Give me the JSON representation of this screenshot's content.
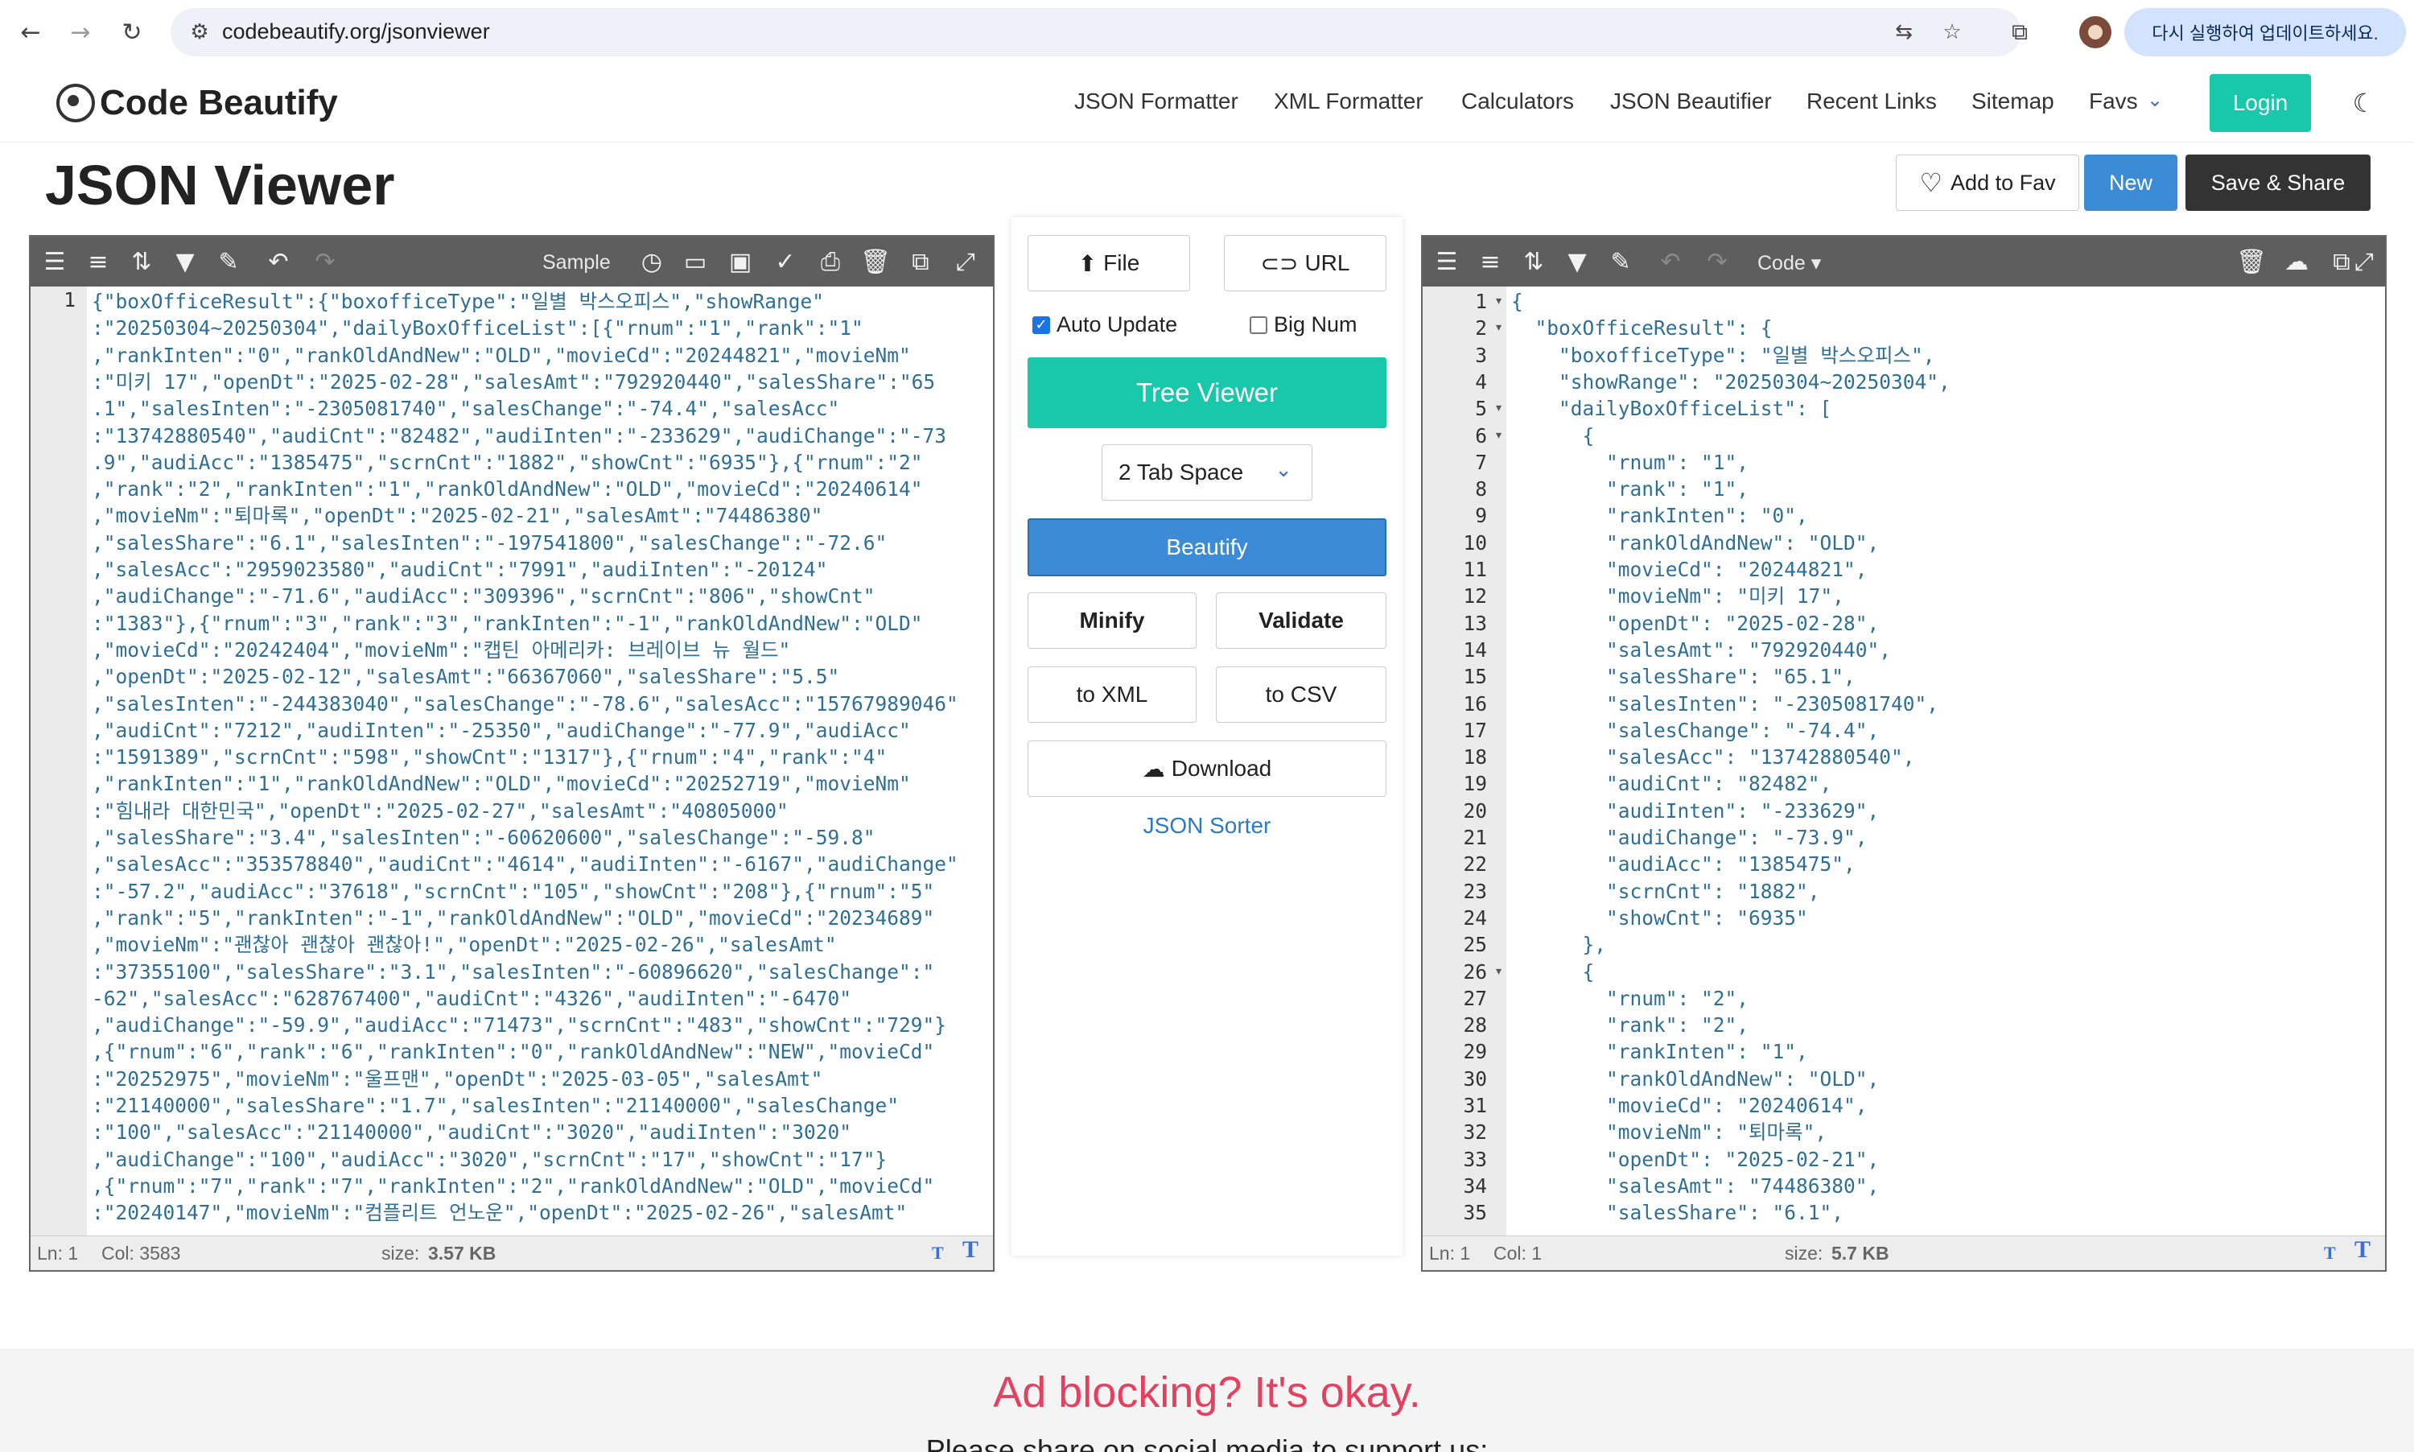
{
  "browser": {
    "url": "codebeautify.org/jsonviewer",
    "update_text": "다시 실행하여 업데이트하세요."
  },
  "site": {
    "logo_text": "Code Beautify",
    "nav": [
      "JSON Formatter",
      "XML Formatter",
      "Calculators",
      "JSON Beautifier",
      "Recent Links",
      "Sitemap",
      "Favs"
    ],
    "login_label": "Login"
  },
  "page": {
    "title": "JSON Viewer",
    "add_fav_label": "Add to Fav",
    "new_label": "New",
    "save_share_label": "Save & Share"
  },
  "left_editor": {
    "sample_label": "Sample",
    "status": {
      "ln": "Ln: 1",
      "col": "Col: 3583",
      "size_label": "size:",
      "size_value": "3.57 KB"
    },
    "gutter_first": "1",
    "lines": [
      "{\"boxOfficeResult\":{\"boxofficeType\":\"일별 박스오피스\",\"showRange\"",
      ":\"20250304~20250304\",\"dailyBoxOfficeList\":[{\"rnum\":\"1\",\"rank\":\"1\"",
      ",\"rankInten\":\"0\",\"rankOldAndNew\":\"OLD\",\"movieCd\":\"20244821\",\"movieNm\"",
      ":\"미키 17\",\"openDt\":\"2025-02-28\",\"salesAmt\":\"792920440\",\"salesShare\":\"65",
      ".1\",\"salesInten\":\"-2305081740\",\"salesChange\":\"-74.4\",\"salesAcc\"",
      ":\"13742880540\",\"audiCnt\":\"82482\",\"audiInten\":\"-233629\",\"audiChange\":\"-73",
      ".9\",\"audiAcc\":\"1385475\",\"scrnCnt\":\"1882\",\"showCnt\":\"6935\"},{\"rnum\":\"2\"",
      ",\"rank\":\"2\",\"rankInten\":\"1\",\"rankOldAndNew\":\"OLD\",\"movieCd\":\"20240614\"",
      ",\"movieNm\":\"퇴마록\",\"openDt\":\"2025-02-21\",\"salesAmt\":\"74486380\"",
      ",\"salesShare\":\"6.1\",\"salesInten\":\"-197541800\",\"salesChange\":\"-72.6\"",
      ",\"salesAcc\":\"2959023580\",\"audiCnt\":\"7991\",\"audiInten\":\"-20124\"",
      ",\"audiChange\":\"-71.6\",\"audiAcc\":\"309396\",\"scrnCnt\":\"806\",\"showCnt\"",
      ":\"1383\"},{\"rnum\":\"3\",\"rank\":\"3\",\"rankInten\":\"-1\",\"rankOldAndNew\":\"OLD\"",
      ",\"movieCd\":\"20242404\",\"movieNm\":\"캡틴 아메리카: 브레이브 뉴 월드\"",
      ",\"openDt\":\"2025-02-12\",\"salesAmt\":\"66367060\",\"salesShare\":\"5.5\"",
      ",\"salesInten\":\"-244383040\",\"salesChange\":\"-78.6\",\"salesAcc\":\"15767989046\"",
      ",\"audiCnt\":\"7212\",\"audiInten\":\"-25350\",\"audiChange\":\"-77.9\",\"audiAcc\"",
      ":\"1591389\",\"scrnCnt\":\"598\",\"showCnt\":\"1317\"},{\"rnum\":\"4\",\"rank\":\"4\"",
      ",\"rankInten\":\"1\",\"rankOldAndNew\":\"OLD\",\"movieCd\":\"20252719\",\"movieNm\"",
      ":\"힘내라 대한민국\",\"openDt\":\"2025-02-27\",\"salesAmt\":\"40805000\"",
      ",\"salesShare\":\"3.4\",\"salesInten\":\"-60620600\",\"salesChange\":\"-59.8\"",
      ",\"salesAcc\":\"353578840\",\"audiCnt\":\"4614\",\"audiInten\":\"-6167\",\"audiChange\"",
      ":\"-57.2\",\"audiAcc\":\"37618\",\"scrnCnt\":\"105\",\"showCnt\":\"208\"},{\"rnum\":\"5\"",
      ",\"rank\":\"5\",\"rankInten\":\"-1\",\"rankOldAndNew\":\"OLD\",\"movieCd\":\"20234689\"",
      ",\"movieNm\":\"괜찮아 괜찮아 괜찮아!\",\"openDt\":\"2025-02-26\",\"salesAmt\"",
      ":\"37355100\",\"salesShare\":\"3.1\",\"salesInten\":\"-60896620\",\"salesChange\":\"",
      "-62\",\"salesAcc\":\"628767400\",\"audiCnt\":\"4326\",\"audiInten\":\"-6470\"",
      ",\"audiChange\":\"-59.9\",\"audiAcc\":\"71473\",\"scrnCnt\":\"483\",\"showCnt\":\"729\"}",
      ",{\"rnum\":\"6\",\"rank\":\"6\",\"rankInten\":\"0\",\"rankOldAndNew\":\"NEW\",\"movieCd\"",
      ":\"20252975\",\"movieNm\":\"울프맨\",\"openDt\":\"2025-03-05\",\"salesAmt\"",
      ":\"21140000\",\"salesShare\":\"1.7\",\"salesInten\":\"21140000\",\"salesChange\"",
      ":\"100\",\"salesAcc\":\"21140000\",\"audiCnt\":\"3020\",\"audiInten\":\"3020\"",
      ",\"audiChange\":\"100\",\"audiAcc\":\"3020\",\"scrnCnt\":\"17\",\"showCnt\":\"17\"}",
      ",{\"rnum\":\"7\",\"rank\":\"7\",\"rankInten\":\"2\",\"rankOldAndNew\":\"OLD\",\"movieCd\"",
      ":\"20240147\",\"movieNm\":\"컴플리트 언노운\",\"openDt\":\"2025-02-26\",\"salesAmt\""
    ]
  },
  "middle": {
    "file_label": "File",
    "url_label": "URL",
    "auto_update_label": "Auto Update",
    "auto_update_checked": true,
    "big_num_label": "Big Num",
    "big_num_checked": false,
    "tree_viewer_label": "Tree Viewer",
    "tab_space_value": "2 Tab Space",
    "beautify_label": "Beautify",
    "minify_label": "Minify",
    "validate_label": "Validate",
    "to_xml_label": "to XML",
    "to_csv_label": "to CSV",
    "download_label": "Download",
    "json_sorter_label": "JSON Sorter"
  },
  "right_editor": {
    "code_label": "Code",
    "status": {
      "ln": "Ln: 1",
      "col": "Col: 1",
      "size_label": "size:",
      "size_value": "5.7 KB"
    },
    "lines": [
      {
        "n": "1",
        "fold": true,
        "t": "{"
      },
      {
        "n": "2",
        "fold": true,
        "t": "  \"boxOfficeResult\": {"
      },
      {
        "n": "3",
        "fold": false,
        "t": "    \"boxofficeType\": \"일별 박스오피스\","
      },
      {
        "n": "4",
        "fold": false,
        "t": "    \"showRange\": \"20250304~20250304\","
      },
      {
        "n": "5",
        "fold": true,
        "t": "    \"dailyBoxOfficeList\": ["
      },
      {
        "n": "6",
        "fold": true,
        "t": "      {"
      },
      {
        "n": "7",
        "fold": false,
        "t": "        \"rnum\": \"1\","
      },
      {
        "n": "8",
        "fold": false,
        "t": "        \"rank\": \"1\","
      },
      {
        "n": "9",
        "fold": false,
        "t": "        \"rankInten\": \"0\","
      },
      {
        "n": "10",
        "fold": false,
        "t": "        \"rankOldAndNew\": \"OLD\","
      },
      {
        "n": "11",
        "fold": false,
        "t": "        \"movieCd\": \"20244821\","
      },
      {
        "n": "12",
        "fold": false,
        "t": "        \"movieNm\": \"미키 17\","
      },
      {
        "n": "13",
        "fold": false,
        "t": "        \"openDt\": \"2025-02-28\","
      },
      {
        "n": "14",
        "fold": false,
        "t": "        \"salesAmt\": \"792920440\","
      },
      {
        "n": "15",
        "fold": false,
        "t": "        \"salesShare\": \"65.1\","
      },
      {
        "n": "16",
        "fold": false,
        "t": "        \"salesInten\": \"-2305081740\","
      },
      {
        "n": "17",
        "fold": false,
        "t": "        \"salesChange\": \"-74.4\","
      },
      {
        "n": "18",
        "fold": false,
        "t": "        \"salesAcc\": \"13742880540\","
      },
      {
        "n": "19",
        "fold": false,
        "t": "        \"audiCnt\": \"82482\","
      },
      {
        "n": "20",
        "fold": false,
        "t": "        \"audiInten\": \"-233629\","
      },
      {
        "n": "21",
        "fold": false,
        "t": "        \"audiChange\": \"-73.9\","
      },
      {
        "n": "22",
        "fold": false,
        "t": "        \"audiAcc\": \"1385475\","
      },
      {
        "n": "23",
        "fold": false,
        "t": "        \"scrnCnt\": \"1882\","
      },
      {
        "n": "24",
        "fold": false,
        "t": "        \"showCnt\": \"6935\""
      },
      {
        "n": "25",
        "fold": false,
        "t": "      },"
      },
      {
        "n": "26",
        "fold": true,
        "t": "      {"
      },
      {
        "n": "27",
        "fold": false,
        "t": "        \"rnum\": \"2\","
      },
      {
        "n": "28",
        "fold": false,
        "t": "        \"rank\": \"2\","
      },
      {
        "n": "29",
        "fold": false,
        "t": "        \"rankInten\": \"1\","
      },
      {
        "n": "30",
        "fold": false,
        "t": "        \"rankOldAndNew\": \"OLD\","
      },
      {
        "n": "31",
        "fold": false,
        "t": "        \"movieCd\": \"20240614\","
      },
      {
        "n": "32",
        "fold": false,
        "t": "        \"movieNm\": \"퇴마록\","
      },
      {
        "n": "33",
        "fold": false,
        "t": "        \"openDt\": \"2025-02-21\","
      },
      {
        "n": "34",
        "fold": false,
        "t": "        \"salesAmt\": \"74486380\","
      },
      {
        "n": "35",
        "fold": false,
        "t": "        \"salesShare\": \"6.1\","
      }
    ]
  },
  "ad": {
    "title": "Ad blocking? It's okay.",
    "subtitle": "Please share on social media to support us:"
  },
  "colors": {
    "accent": "#19c7aa",
    "primary": "#3b8bd6",
    "dark": "#333333",
    "ad_red": "#e4405f"
  }
}
